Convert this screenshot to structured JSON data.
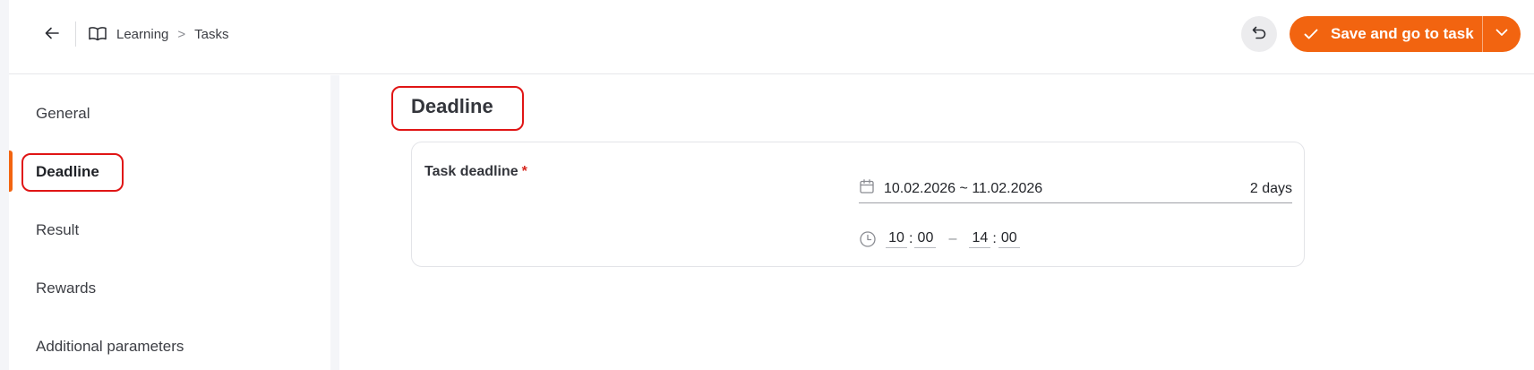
{
  "header": {
    "breadcrumb": [
      "Learning",
      "Tasks"
    ],
    "breadcrumb_separator": ">",
    "save_label": "Save and go to task"
  },
  "sidebar": {
    "items": [
      {
        "label": "General",
        "active": false
      },
      {
        "label": "Deadline",
        "active": true
      },
      {
        "label": "Result",
        "active": false
      },
      {
        "label": "Rewards",
        "active": false
      },
      {
        "label": "Additional parameters",
        "active": false
      }
    ]
  },
  "main": {
    "section_title": "Deadline",
    "task_deadline": {
      "label": "Task deadline",
      "required_mark": "*",
      "date_range": "10.02.2026 ~ 11.02.2026",
      "duration": "2 days",
      "start_hour": "10",
      "start_minute": "00",
      "end_hour": "14",
      "end_minute": "00",
      "time_separator": ":",
      "range_separator": "–"
    }
  },
  "colors": {
    "accent": "#f26410",
    "highlight": "#e01515",
    "required": "#d6281f",
    "gutter": "#f4f5f8"
  },
  "icons": [
    "arrow-left-icon",
    "book-open-icon",
    "undo-icon",
    "check-icon",
    "chevron-down-icon",
    "calendar-icon",
    "clock-icon"
  ]
}
